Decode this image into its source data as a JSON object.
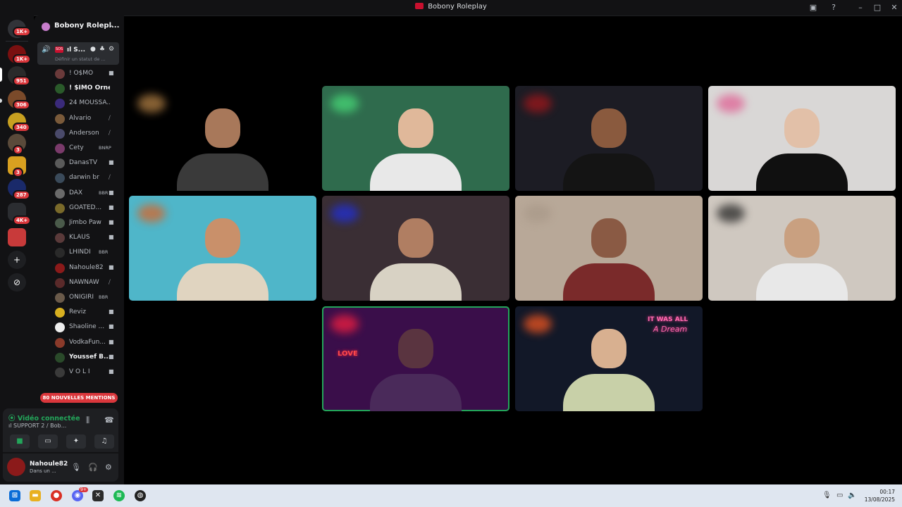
{
  "window": {
    "title": "Bobony Roleplay",
    "controls": {
      "minimize": "–",
      "maximize": "□",
      "close": "✕"
    }
  },
  "server_rail": {
    "badges": [
      "1K+",
      "1K+",
      "951",
      "306",
      "340",
      "3",
      "3",
      "287",
      "4K+"
    ],
    "add_server": "+",
    "discover": "⊘"
  },
  "guild": {
    "name": "Bobony Rolepl...",
    "chevron": "⌄"
  },
  "voice_channel": {
    "name": "ıl S...",
    "status_placeholder": "Définir un statut de ...",
    "members": [
      {
        "name": "! O$MO",
        "tag": "",
        "state": "cam",
        "bright": false
      },
      {
        "name": "! $IMO Ornes...",
        "tag": "",
        "state": "none",
        "bright": true
      },
      {
        "name": "24 MOUSSA...",
        "tag": "",
        "state": "none",
        "bright": false
      },
      {
        "name": "Alvario",
        "tag": "",
        "state": "muted",
        "bright": false
      },
      {
        "name": "Anderson",
        "tag": "",
        "state": "muted",
        "bright": false
      },
      {
        "name": "Cety",
        "tag": "BNRP",
        "state": "none",
        "bright": false
      },
      {
        "name": "DanasTV",
        "tag": "",
        "state": "cam",
        "bright": false
      },
      {
        "name": "darwin br",
        "tag": "",
        "state": "muted",
        "bright": false
      },
      {
        "name": "DAX",
        "tag": "BBR",
        "state": "cam",
        "bright": false
      },
      {
        "name": "GOATED...",
        "tag": "",
        "state": "cam",
        "bright": false
      },
      {
        "name": "Jimbo Paw",
        "tag": "",
        "state": "cam",
        "bright": false
      },
      {
        "name": "KLAUS",
        "tag": "",
        "state": "cam",
        "bright": false
      },
      {
        "name": "LHINDI",
        "tag": "BBR",
        "state": "none",
        "bright": false
      },
      {
        "name": "Nahoule82",
        "tag": "",
        "state": "cam",
        "bright": false
      },
      {
        "name": "NAWNAW",
        "tag": "",
        "state": "muted",
        "bright": false
      },
      {
        "name": "ONIGIRI",
        "tag": "BBR",
        "state": "none",
        "bright": false
      },
      {
        "name": "Reviz",
        "tag": "",
        "state": "cam",
        "bright": false
      },
      {
        "name": "Shaoline ...",
        "tag": "",
        "state": "cam",
        "bright": false
      },
      {
        "name": "VodkaFun...",
        "tag": "",
        "state": "cam",
        "bright": false
      },
      {
        "name": "Youssef B...",
        "tag": "",
        "state": "cam",
        "bright": true
      },
      {
        "name": "V O L I",
        "tag": "",
        "state": "cam",
        "bright": false
      }
    ]
  },
  "mentions_banner": "80 NOUVELLES MENTIONS",
  "voice_status": {
    "connected": "Vidéo connectée",
    "channel": "ıl SUPPORT 2 / Bob..."
  },
  "user": {
    "name": "Nahoule82",
    "status": "Dans un ..."
  },
  "video_tiles": [
    {
      "col": 0,
      "row": 0,
      "speaking": false,
      "bg": "#000000",
      "skin": "#a8785a",
      "shirt": "#3a3a3a",
      "accent": "#c08a4a"
    },
    {
      "col": 1,
      "row": 0,
      "speaking": false,
      "bg": "#2f6b4d",
      "skin": "#e0b89a",
      "shirt": "#e8e8e8",
      "accent": "#49e07a"
    },
    {
      "col": 2,
      "row": 0,
      "speaking": false,
      "bg": "#1c1c24",
      "skin": "#8a5a3e",
      "shirt": "#141414",
      "accent": "#a8161a"
    },
    {
      "col": 3,
      "row": 0,
      "speaking": false,
      "bg": "#d9d7d6",
      "skin": "#e2c0a8",
      "shirt": "#101010",
      "accent": "#e05a90"
    },
    {
      "col": 0,
      "row": 1,
      "speaking": false,
      "bg": "#4fb6c9",
      "skin": "#c9906a",
      "shirt": "#e0d4c0",
      "accent": "#e06020"
    },
    {
      "col": 1,
      "row": 1,
      "speaking": false,
      "bg": "#3a2e34",
      "skin": "#b07e62",
      "shirt": "#d8d2c4",
      "accent": "#2030e0"
    },
    {
      "col": 2,
      "row": 1,
      "speaking": false,
      "bg": "#b8a898",
      "skin": "#8a5a44",
      "shirt": "#7a2a2a",
      "accent": "#a89888"
    },
    {
      "col": 3,
      "row": 1,
      "speaking": false,
      "bg": "#cfc8c0",
      "skin": "#c9a080",
      "shirt": "#e8e8e8",
      "accent": "#1c1c1c"
    },
    {
      "col": 1,
      "row": 2,
      "speaking": true,
      "bg": "#3a0e4a",
      "skin": "#5a3440",
      "shirt": "#4a2a5a",
      "accent": "#ff2040"
    },
    {
      "col": 2,
      "row": 2,
      "speaking": false,
      "bg": "#121828",
      "skin": "#d8b090",
      "shirt": "#c8d0a8",
      "accent": "#ff5a20"
    }
  ],
  "tile_overlay": {
    "love_sign": "LOVE",
    "neon_sign_line1": "IT WAS ALL",
    "neon_sign_line2": "A Dream"
  },
  "taskbar": {
    "time": "00:17",
    "date": "13/08/2025",
    "discord_badge": "9+"
  }
}
